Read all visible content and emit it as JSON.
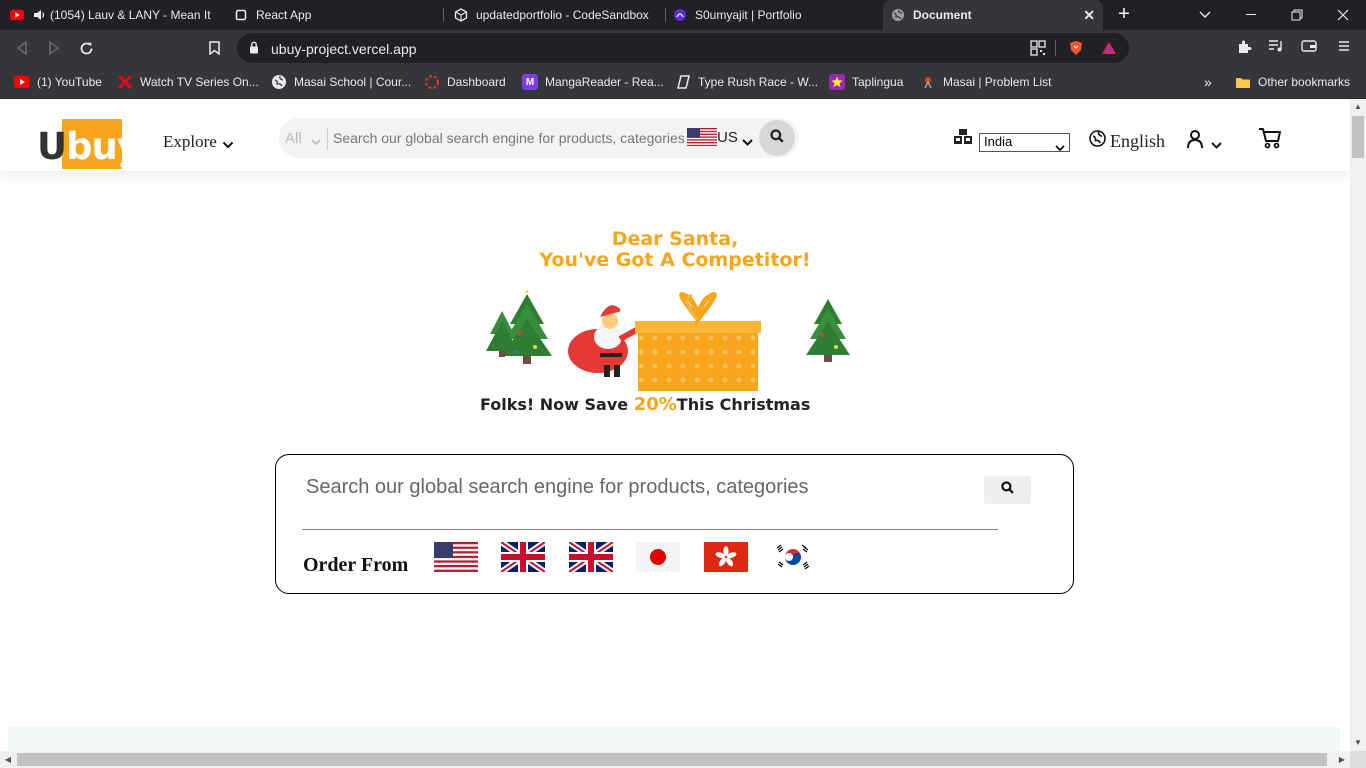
{
  "browser": {
    "tabs": [
      {
        "title": "(1054) Lauv & LANY - Mean It",
        "icon": "youtube-icon",
        "audio": true
      },
      {
        "title": "React App",
        "icon": "react-app-icon"
      },
      {
        "title": "updatedportfolio - CodeSandbox",
        "icon": "codesandbox-icon"
      },
      {
        "title": "S0umyajit | Portfolio",
        "icon": "portfolio-icon"
      },
      {
        "title": "Document",
        "icon": "globe-icon",
        "active": true
      }
    ],
    "url": "ubuy-project.vercel.app",
    "bookmarks": [
      {
        "label": "(1) YouTube",
        "color": "#ff0000"
      },
      {
        "label": "Watch TV Series On...",
        "color": "#e50914"
      },
      {
        "label": "Masai School | Cour...",
        "color": "#555555"
      },
      {
        "label": "Dashboard",
        "color": "#e53935"
      },
      {
        "label": "MangaReader - Rea...",
        "color": "#7b3fe4"
      },
      {
        "label": "Type Rush Race - W...",
        "color": "#ffffff"
      },
      {
        "label": "Taplingua",
        "color": "#9c27b0"
      },
      {
        "label": "Masai | Problem List",
        "color": "#444444"
      }
    ],
    "more_bookmarks": "»",
    "other_bookmarks": "Other bookmarks"
  },
  "header": {
    "logo_first": "U",
    "logo_rest": "buy",
    "explore": "Explore",
    "search_category": "All",
    "search_placeholder": "Search our global search engine for products, categories",
    "store_country": "US",
    "ship_to_country": "India",
    "language": "English"
  },
  "banner": {
    "line1": "Dear Santa,",
    "line2": "You've Got A Competitor!",
    "tagline_before": "Folks! Now Save ",
    "tagline_highlight": "20%",
    "tagline_after": "This Christmas"
  },
  "search_card": {
    "placeholder": "Search our global search engine for products, categories",
    "order_from": "Order From",
    "flags": [
      "us-flag-icon",
      "uk-flag-icon",
      "uk-flag-icon",
      "japan-flag-icon",
      "hong-kong-flag-icon",
      "korea-flag-icon"
    ]
  },
  "colors": {
    "brand": "#f7a51c",
    "chrome_dark": "#202124",
    "chrome_toolbar": "#35363a"
  }
}
